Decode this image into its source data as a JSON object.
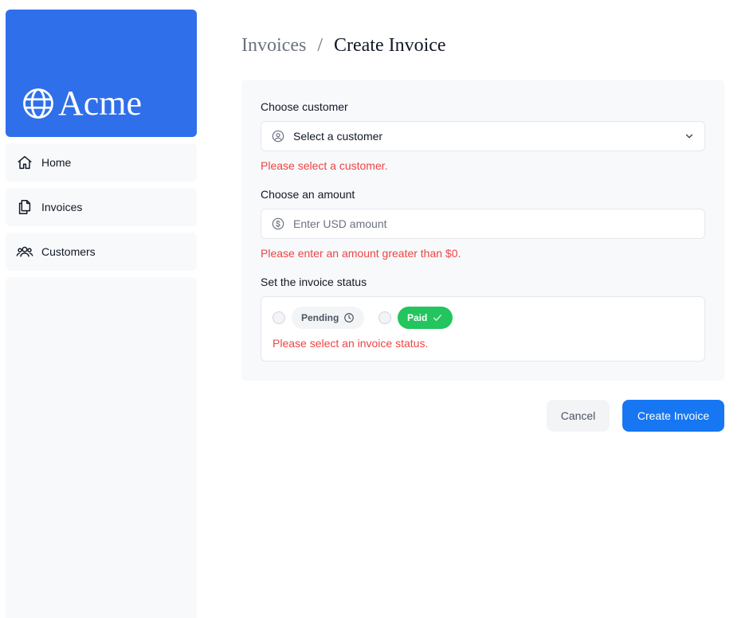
{
  "app": {
    "logo_text": "Acme"
  },
  "sidebar": {
    "items": [
      {
        "label": "Home",
        "icon": "home-icon"
      },
      {
        "label": "Invoices",
        "icon": "documents-icon"
      },
      {
        "label": "Customers",
        "icon": "users-icon"
      }
    ]
  },
  "breadcrumb": {
    "parent": "Invoices",
    "separator": "/",
    "current": "Create Invoice"
  },
  "form": {
    "customer": {
      "label": "Choose customer",
      "selected": "Select a customer",
      "error": "Please select a customer."
    },
    "amount": {
      "label": "Choose an amount",
      "placeholder": "Enter USD amount",
      "error": "Please enter an amount greater than $0."
    },
    "status": {
      "label": "Set the invoice status",
      "options": [
        {
          "label": "Pending",
          "icon": "clock-icon",
          "checked": false
        },
        {
          "label": "Paid",
          "icon": "check-icon",
          "checked": false
        }
      ],
      "error": "Please select an invoice status."
    }
  },
  "actions": {
    "cancel_label": "Cancel",
    "submit_label": "Create Invoice"
  },
  "colors": {
    "brand": "#2f6fea",
    "primary_button": "#1777f2",
    "error": "#ef4444",
    "paid": "#22c55e"
  }
}
